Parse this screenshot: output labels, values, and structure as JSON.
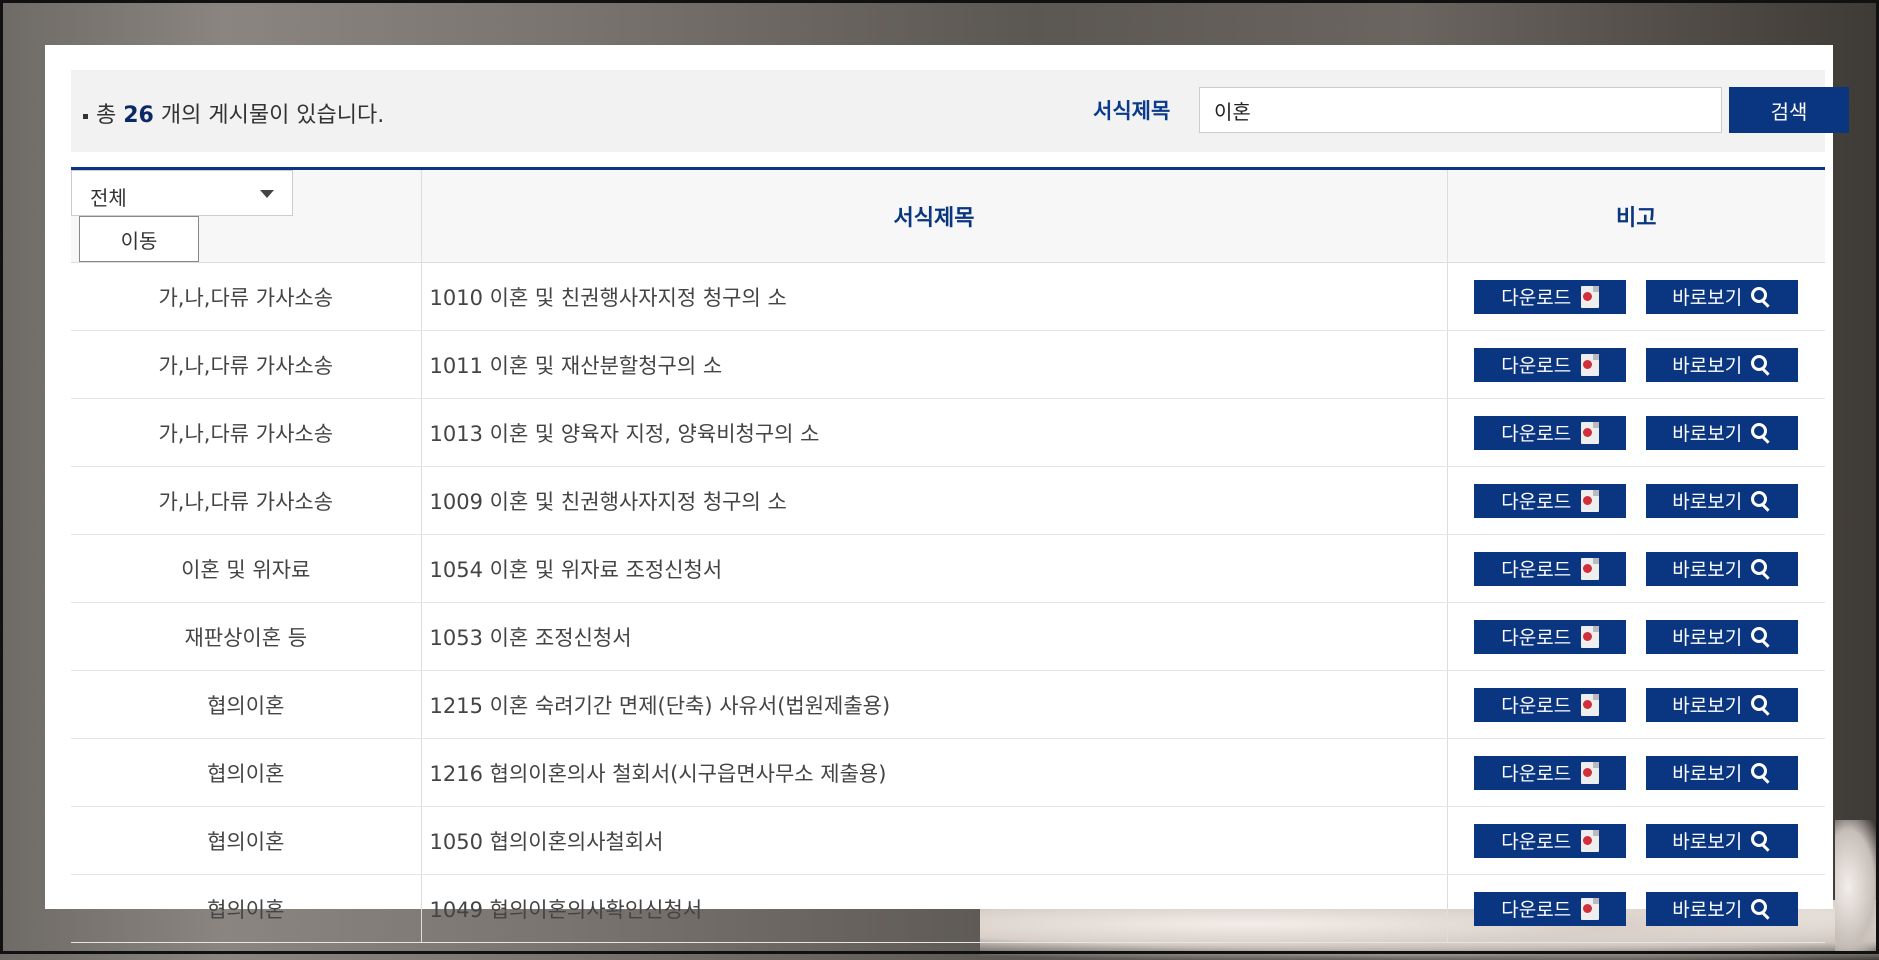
{
  "info": {
    "prefix": "총",
    "count": "26",
    "suffix": "개의 게시물이 있습니다."
  },
  "search": {
    "label": "서식제목",
    "value": "이혼",
    "button": "검색"
  },
  "filter": {
    "selected": "전체",
    "move_button": "이동"
  },
  "columns": {
    "title": "서식제목",
    "note": "비고"
  },
  "actions": {
    "download": "다운로드",
    "view": "바로보기"
  },
  "rows": [
    {
      "category": "가,나,다류 가사소송",
      "title": "1010 이혼 및 친권행사자지정 청구의 소"
    },
    {
      "category": "가,나,다류 가사소송",
      "title": "1011 이혼 및 재산분할청구의 소"
    },
    {
      "category": "가,나,다류 가사소송",
      "title": "1013 이혼 및 양육자 지정, 양육비청구의 소"
    },
    {
      "category": "가,나,다류 가사소송",
      "title": "1009 이혼 및 친권행사자지정 청구의 소"
    },
    {
      "category": "이혼 및 위자료",
      "title": "1054 이혼 및 위자료 조정신청서"
    },
    {
      "category": "재판상이혼 등",
      "title": "1053 이혼 조정신청서"
    },
    {
      "category": "협의이혼",
      "title": "1215 이혼 숙려기간 면제(단축) 사유서(법원제출용)"
    },
    {
      "category": "협의이혼",
      "title": "1216 협의이혼의사 철회서(시구읍면사무소 제출용)"
    },
    {
      "category": "협의이혼",
      "title": "1050 협의이혼의사철회서"
    },
    {
      "category": "협의이혼",
      "title": "1049 협의이혼의사확인신청서"
    }
  ]
}
